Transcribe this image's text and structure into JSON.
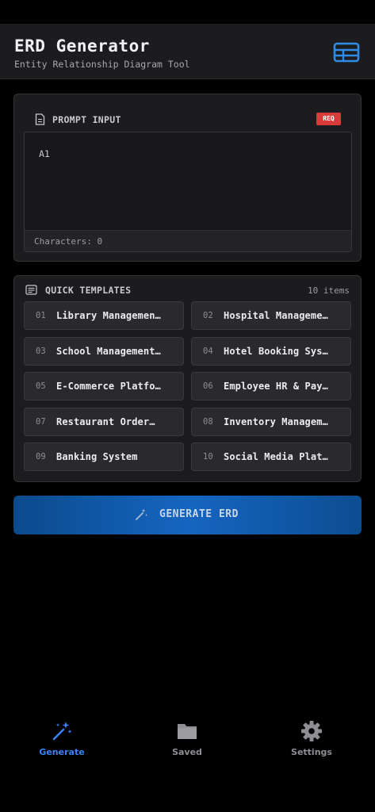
{
  "header": {
    "title": "ERD Generator",
    "subtitle": "Entity Relationship Diagram Tool",
    "table_icon": "table-grid-icon"
  },
  "prompt": {
    "section_title": "PROMPT INPUT",
    "required_badge": "REQ",
    "value": "A1",
    "characters_label": "Characters: 0"
  },
  "templates": {
    "section_title": "QUICK TEMPLATES",
    "count_label": "10 items",
    "items": [
      {
        "num": "01",
        "label": "Library Managemen…"
      },
      {
        "num": "02",
        "label": "Hospital Manageme…"
      },
      {
        "num": "03",
        "label": "School Management…"
      },
      {
        "num": "04",
        "label": "Hotel Booking Sys…"
      },
      {
        "num": "05",
        "label": "E-Commerce Platfo…"
      },
      {
        "num": "06",
        "label": "Employee HR & Pay…"
      },
      {
        "num": "07",
        "label": "Restaurant Order…"
      },
      {
        "num": "08",
        "label": "Inventory Managem…"
      },
      {
        "num": "09",
        "label": "Banking System"
      },
      {
        "num": "10",
        "label": "Social Media Plat…"
      }
    ]
  },
  "generate_button": {
    "label": "GENERATE ERD",
    "icon": "magic-wand-icon"
  },
  "tabbar": {
    "tabs": [
      {
        "label": "Generate",
        "icon": "sparkle-wand-icon",
        "active": true
      },
      {
        "label": "Saved",
        "icon": "folder-icon",
        "active": false
      },
      {
        "label": "Settings",
        "icon": "gear-icon",
        "active": false
      }
    ]
  },
  "colors": {
    "accent": "#3b82f6",
    "badge_red": "#d93b3b",
    "button_blue": "#1565c0",
    "card_bg": "#1c1c1e"
  }
}
